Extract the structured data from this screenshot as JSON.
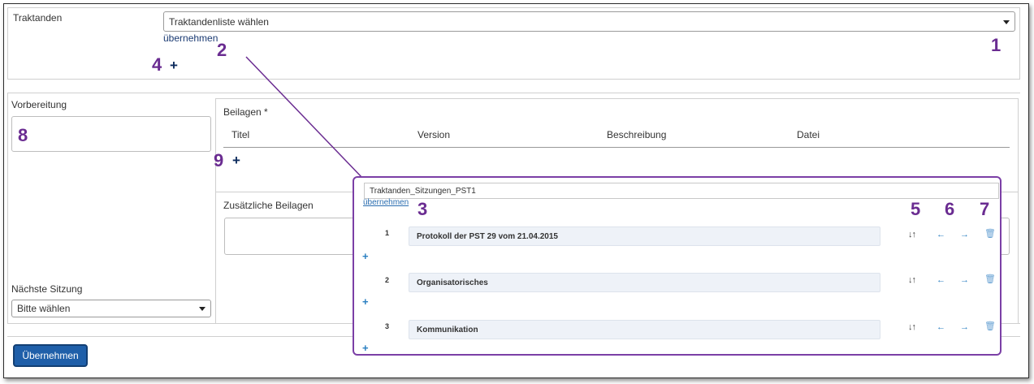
{
  "traktanden": {
    "label": "Traktanden",
    "select_value": "Traktandenliste wählen",
    "apply_link": "übernehmen"
  },
  "vorbereitung": {
    "label": "Vorbereitung"
  },
  "beilagen": {
    "label": "Beilagen *",
    "columns": [
      "Titel",
      "Version",
      "Beschreibung",
      "Datei"
    ]
  },
  "zusaetzliche_beilagen": {
    "label": "Zusätzliche Beilagen"
  },
  "naechste_sitzung": {
    "label": "Nächste Sitzung",
    "select_value": "Bitte wählen"
  },
  "submit_button": {
    "label": "Übernehmen"
  },
  "popup": {
    "list_name": "Traktanden_Sitzungen_PST1",
    "apply_link": "übernehmen",
    "items": [
      {
        "number": "1",
        "title": "Protokoll der PST 29 vom 21.04.2015"
      },
      {
        "number": "2",
        "title": "Organisatorisches"
      },
      {
        "number": "3",
        "title": "Kommunikation"
      }
    ]
  },
  "callouts": [
    "1",
    "2",
    "3",
    "4",
    "5",
    "6",
    "7",
    "8",
    "9"
  ],
  "icons": {
    "add": "plus-icon",
    "sort": "sort-icon",
    "indent_left": "arrow-left-icon",
    "indent_right": "arrow-right-icon",
    "delete": "trash-icon"
  },
  "colors": {
    "callout": "#6a2c91",
    "button": "#1f5fa9",
    "link": "#1a3a72",
    "icon_blue": "#2a7fc1"
  }
}
